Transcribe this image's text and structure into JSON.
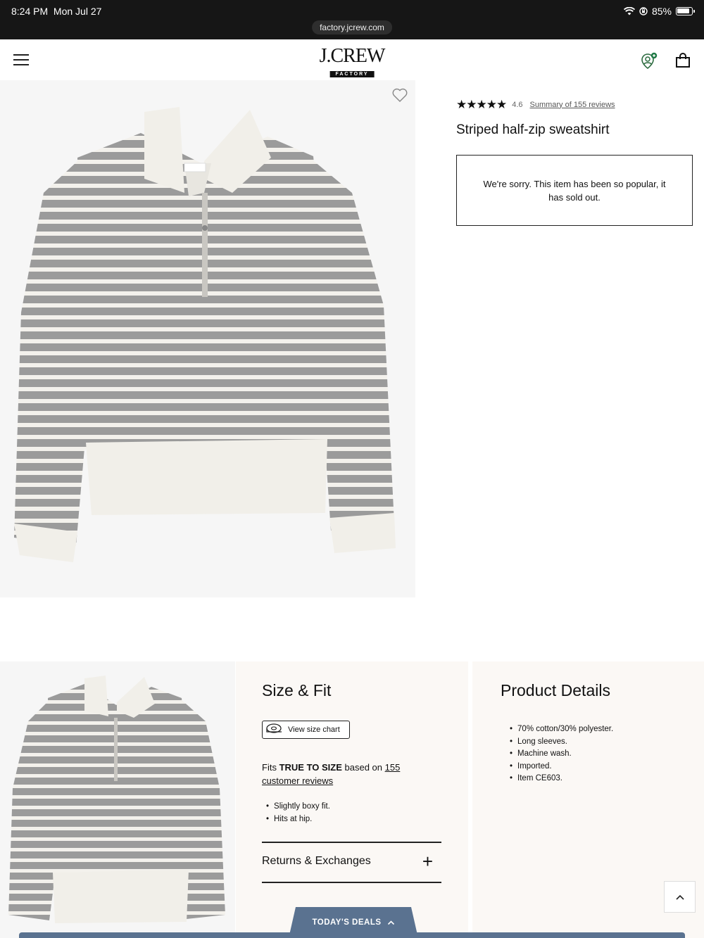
{
  "status_bar": {
    "time": "8:24 PM",
    "date": "Mon Jul 27",
    "battery": "85%",
    "url": "factory.jcrew.com"
  },
  "header": {
    "logo_main": "J.CREW",
    "logo_sub": "FACTORY",
    "icons": [
      "hamburger-menu-icon",
      "account-icon",
      "shopping-bag-icon"
    ]
  },
  "product": {
    "rating": "4.6",
    "stars": "★★★★★",
    "reviews_link": "Summary of 155 reviews",
    "title": "Striped half-zip sweatshirt",
    "soldout_message": "We're sorry. This item has been so popular, it has sold out."
  },
  "size_fit": {
    "title": "Size & Fit",
    "size_chart_label": "View size chart",
    "fit_prefix": "Fits ",
    "fit_strong": "TRUE TO SIZE",
    "fit_mid": " based on ",
    "fit_link": "155 customer reviews",
    "bullets": [
      "Slightly boxy fit.",
      "Hits at hip."
    ],
    "returns_label": "Returns & Exchanges"
  },
  "product_details": {
    "title": "Product Details",
    "bullets": [
      "70% cotton/30% polyester.",
      "Long sleeves.",
      "Machine wash.",
      "Imported.",
      "Item CE603."
    ]
  },
  "deals": {
    "label": "TODAY'S DEALS"
  },
  "colors": {
    "status_bar": "#161616",
    "deals_blue": "#5a7290",
    "panel_bg": "#fbf8f5",
    "sweater_grey": "#9a9a9a",
    "sweater_cream": "#f1efe9"
  }
}
